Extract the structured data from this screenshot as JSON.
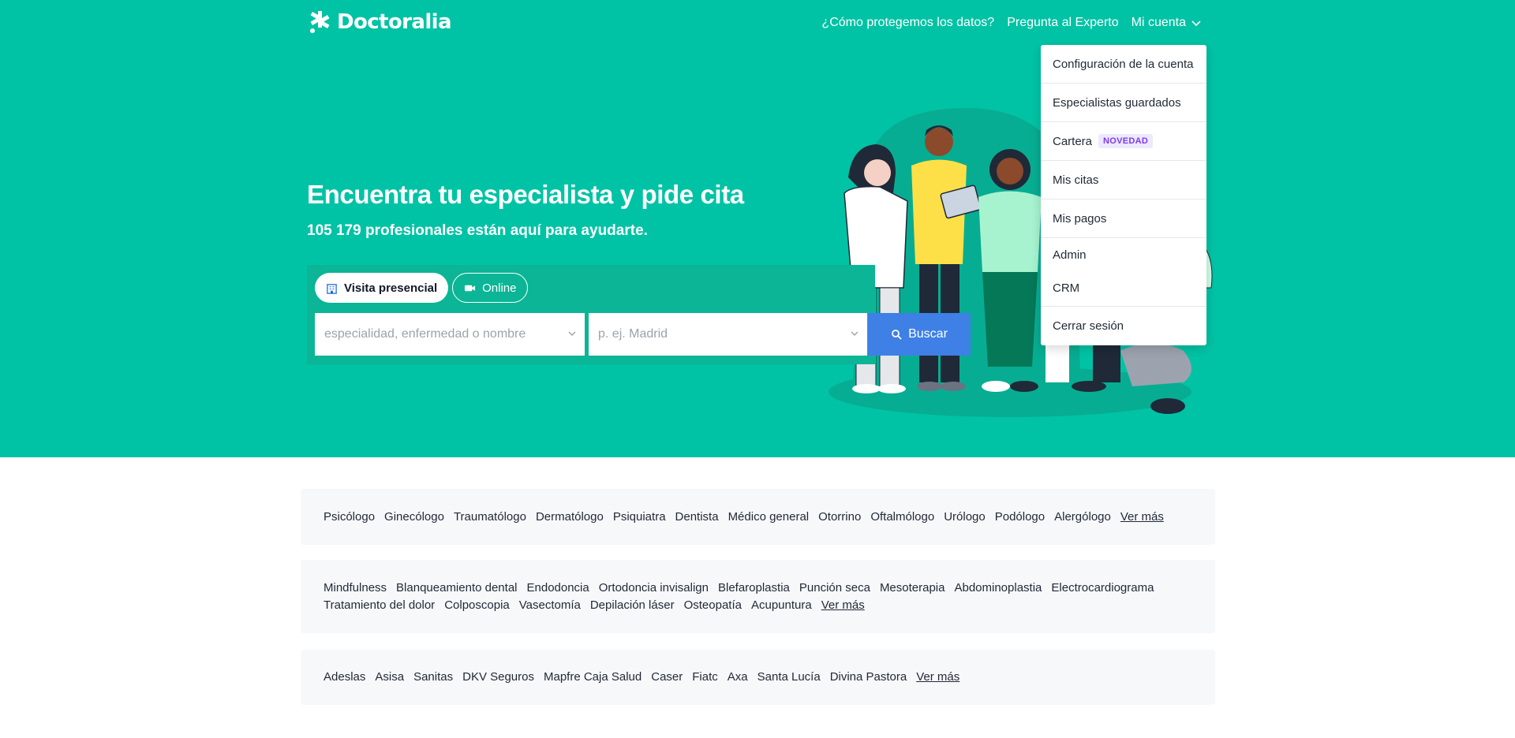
{
  "brand": {
    "name": "Doctoralia"
  },
  "nav": {
    "privacy": "¿Cómo protegemos los datos?",
    "expert": "Pregunta al Experto",
    "account": "Mi cuenta"
  },
  "hero": {
    "title": "Encuentra tu especialista y pide cita",
    "subtitle": "105 179 profesionales están aquí para ayudarte."
  },
  "search": {
    "tab_in_person": "Visita presencial",
    "tab_online": "Online",
    "specialty_placeholder": "especialidad, enfermedad o nombre",
    "location_placeholder": "p. ej. Madrid",
    "button": "Buscar"
  },
  "account_menu": {
    "items": [
      {
        "label": "Configuración de la cuenta"
      },
      {
        "label": "Especialistas guardados"
      },
      {
        "label": "Cartera",
        "badge": "NOVEDAD"
      },
      {
        "label": "Mis citas"
      },
      {
        "label": "Mis pagos"
      },
      {
        "label": "Admin"
      },
      {
        "label": "CRM"
      },
      {
        "label": "Cerrar sesión"
      }
    ]
  },
  "specialties": {
    "items": [
      "Psicólogo",
      "Ginecólogo",
      "Traumatólogo",
      "Dermatólogo",
      "Psiquiatra",
      "Dentista",
      "Médico general",
      "Otorrino",
      "Oftalmólogo",
      "Urólogo",
      "Podólogo",
      "Alergólogo"
    ],
    "more": "Ver más"
  },
  "treatments": {
    "items": [
      "Mindfulness",
      "Blanqueamiento dental",
      "Endodoncia",
      "Ortodoncia invisalign",
      "Blefaroplastia",
      "Punción seca",
      "Mesoterapia",
      "Abdominoplastia",
      "Electrocardiograma",
      "Tratamiento del dolor",
      "Colposcopia",
      "Vasectomía",
      "Depilación láser",
      "Osteopatía",
      "Acupuntura"
    ],
    "more": "Ver más"
  },
  "insurers": {
    "items": [
      "Adeslas",
      "Asisa",
      "Sanitas",
      "DKV Seguros",
      "Mapfre Caja Salud",
      "Caser",
      "Fiatc",
      "Axa",
      "Santa Lucía",
      "Divina Pastora"
    ],
    "more": "Ver más"
  },
  "colors": {
    "hero_bg": "#00c3a5",
    "search_panel": "#0bb596",
    "button_blue": "#3f80e6",
    "badge_bg": "#ede9fe",
    "badge_text": "#7c3aed",
    "bar_bg": "#f7f8fa"
  }
}
